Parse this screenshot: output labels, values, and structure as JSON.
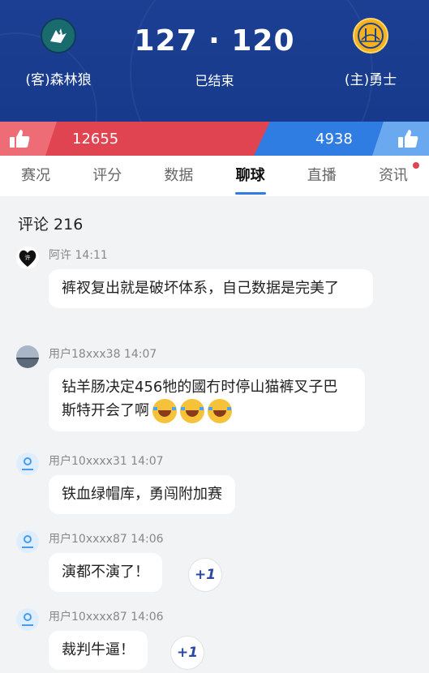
{
  "game": {
    "away_team": "(客)森林狼",
    "home_team": "(主)勇士",
    "score": "127 · 120",
    "status": "已结束",
    "away_logo_icon": "wolves-logo-icon",
    "home_logo_icon": "warriors-logo-icon"
  },
  "votes": {
    "left_count": "12655",
    "right_count": "4938",
    "left_color": "#e04450",
    "right_color": "#2f7de3"
  },
  "tabs": [
    "赛况",
    "评分",
    "数据",
    "聊球",
    "直播",
    "资讯"
  ],
  "active_tab": "聊球",
  "comments_header": "评论 216",
  "comments": [
    {
      "author_time": "阿许 14:11",
      "text": "裤衩复出就是破坏体系，自己数据是完美了"
    },
    {
      "author_time": "用户18xxx38 14:07",
      "text": "钻羊肠决定456牠的國冇时停山猫裤叉子巴斯特开会了啊"
    },
    {
      "author_time": "用户10xxxx31 14:07",
      "text": "铁血绿帽库，勇闯附加赛"
    },
    {
      "author_time": "用户10xxxx87 14:06",
      "text": "演都不演了！",
      "plus": "+1"
    },
    {
      "author_time": "用户10xxxx87 14:06",
      "text": "裁判牛逼！",
      "plus": "+1"
    }
  ]
}
